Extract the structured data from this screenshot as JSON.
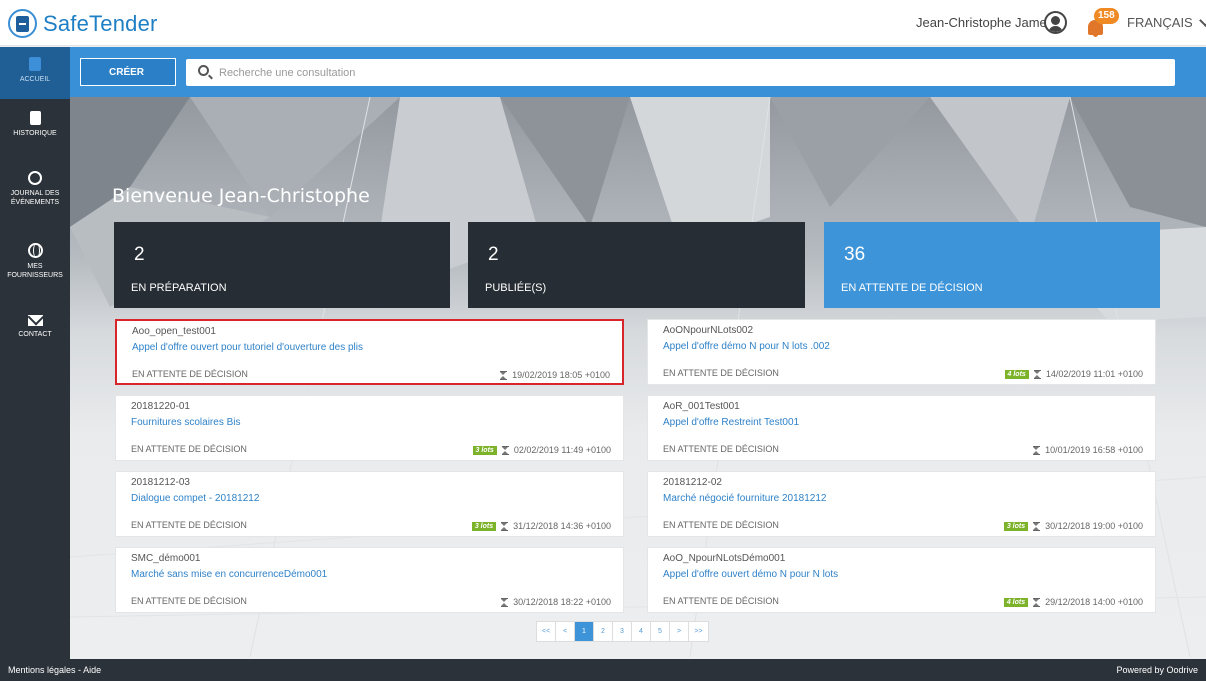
{
  "app": {
    "name": "SafeTender",
    "user_name": "Jean-Christophe Jamet",
    "notification_count": "158",
    "language": "FRANÇAIS"
  },
  "sidebar": {
    "items": [
      {
        "label": "ACCUEIL",
        "icon": "book-icon",
        "active": true
      },
      {
        "label": "HISTORIQUE",
        "icon": "document-icon"
      },
      {
        "label_line1": "JOURNAL DES",
        "label_line2": "ÉVÉNEMENTS",
        "icon": "history-clock-icon"
      },
      {
        "label_line1": "MES",
        "label_line2": "FOURNISSEURS",
        "icon": "globe-icon"
      },
      {
        "label": "CONTACT",
        "icon": "mail-icon"
      }
    ]
  },
  "toolbar": {
    "create_label": "CRÉER",
    "search_placeholder": "Recherche une consultation"
  },
  "hero": {
    "welcome": "Bienvenue Jean-Christophe"
  },
  "stats": [
    {
      "count": "2",
      "label": "EN PRÉPARATION"
    },
    {
      "count": "2",
      "label": "PUBLIÉE(S)"
    },
    {
      "count": "36",
      "label": "EN ATTENTE DE DÉCISION"
    }
  ],
  "consultations": [
    {
      "ref": "Aoo_open_test001",
      "title": "Appel d'offre ouvert pour tutoriel d'ouverture des plis",
      "status": "EN ATTENTE DE DÉCISION",
      "lots": "",
      "date": "19/02/2019 18:05 +0100",
      "highlighted": true
    },
    {
      "ref": "AoONpourNLots002",
      "title": "Appel d'offre démo N pour N lots .002",
      "status": "EN ATTENTE DE DÉCISION",
      "lots": "4 lots",
      "date": "14/02/2019 11:01 +0100"
    },
    {
      "ref": "20181220-01",
      "title": "Fournitures scolaires Bis",
      "status": "EN ATTENTE DE DÉCISION",
      "lots": "3 lots",
      "date": "02/02/2019 11:49 +0100"
    },
    {
      "ref": "AoR_001Test001",
      "title": "Appel d'offre Restreint Test001",
      "status": "EN ATTENTE DE DÉCISION",
      "lots": "",
      "date": "10/01/2019 16:58 +0100"
    },
    {
      "ref": "20181212-03",
      "title": "Dialogue compet - 20181212",
      "status": "EN ATTENTE DE DÉCISION",
      "lots": "3 lots",
      "date": "31/12/2018 14:36 +0100"
    },
    {
      "ref": "20181212-02",
      "title": "Marché négocié fourniture 20181212",
      "status": "EN ATTENTE DE DÉCISION",
      "lots": "3 lots",
      "date": "30/12/2018 19:00 +0100"
    },
    {
      "ref": "SMC_démo001",
      "title": "Marché sans mise en concurrenceDémo001",
      "status": "EN ATTENTE DE DÉCISION",
      "lots": "",
      "date": "30/12/2018 18:22 +0100"
    },
    {
      "ref": "AoO_NpourNLotsDémo001",
      "title": "Appel d'offre ouvert démo N pour N lots",
      "status": "EN ATTENTE DE DÉCISION",
      "lots": "4 lots",
      "date": "29/12/2018 14:00 +0100"
    }
  ],
  "pagination": {
    "buttons": [
      "<<",
      "<",
      "1",
      "2",
      "3",
      "4",
      "5",
      ">",
      ">>"
    ],
    "current": "1"
  },
  "footer": {
    "mentions": "Mentions légales",
    "separator": " - ",
    "aide": "Aide",
    "powered_by": "Powered by Oodrive"
  },
  "colors": {
    "accent": "#3a90d6",
    "sidebar": "#2b3239",
    "stat_dark": "#262d34",
    "highlight": "#d8252a",
    "lots_badge": "#7cb32a",
    "notification": "#f08a24"
  }
}
